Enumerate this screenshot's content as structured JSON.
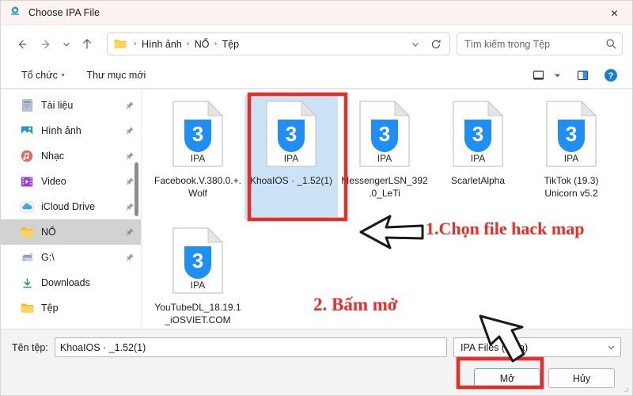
{
  "window": {
    "title": "Choose IPA File",
    "title_icon": "gear-app-icon",
    "close_label": "✕"
  },
  "nav": {
    "back": "back-arrow",
    "forward": "forward-arrow",
    "recent": "recent-dropdown",
    "up": "up-arrow",
    "refresh_label": "refresh-icon",
    "breadcrumb_dropdown": "chevron-down-icon"
  },
  "address": {
    "crumbs": [
      "Hình ảnh",
      "NỔ",
      "Tệp"
    ],
    "separator": "›"
  },
  "search": {
    "placeholder": "Tìm kiếm trong Tệp",
    "value": "",
    "icon": "search-icon"
  },
  "commandbar": {
    "organize": "Tổ chức",
    "organize_caret": "▾",
    "new_folder": "Thư mục mới",
    "view_icon": "view-layout-icon",
    "view_caret": "▾",
    "pane_icon": "preview-pane-icon",
    "help_icon": "help-icon"
  },
  "sidebar": {
    "items": [
      {
        "label": "Tài liệu",
        "icon": "documents-icon",
        "pinned": true,
        "selected": false
      },
      {
        "label": "Hình ảnh",
        "icon": "pictures-icon",
        "pinned": true,
        "selected": false
      },
      {
        "label": "Nhạc",
        "icon": "music-icon",
        "pinned": true,
        "selected": false
      },
      {
        "label": "Video",
        "icon": "video-icon",
        "pinned": true,
        "selected": false
      },
      {
        "label": "iCloud Drive",
        "icon": "icloud-icon",
        "pinned": true,
        "selected": false
      },
      {
        "label": "NỔ",
        "icon": "folder-icon",
        "pinned": true,
        "selected": true
      },
      {
        "label": "G:\\",
        "icon": "drive-icon",
        "pinned": true,
        "selected": false
      },
      {
        "label": "Downloads",
        "icon": "downloads-icon",
        "pinned": false,
        "selected": false
      },
      {
        "label": "Tệp",
        "icon": "folder-icon",
        "pinned": false,
        "selected": false
      }
    ]
  },
  "files": [
    {
      "name": "Facebook.V.380.0.+.Wolf",
      "type": "IPA",
      "selected": false
    },
    {
      "name": "KhoaIOS · _1.52(1)",
      "type": "IPA",
      "selected": true
    },
    {
      "name": "MessengerLSN_392.0_LeTi",
      "type": "IPA",
      "selected": false
    },
    {
      "name": "ScarletAlpha",
      "type": "IPA",
      "selected": false
    },
    {
      "name": "TikTok (19.3) Unicorn v5.2",
      "type": "IPA",
      "selected": false
    },
    {
      "name": "YouTubeDL_18.19.1_iOSVIET.COM",
      "type": "IPA",
      "selected": false
    }
  ],
  "footer": {
    "filename_label": "Tên tệp:",
    "filename_value": "KhoaIOS · _1.52(1)",
    "filename_placeholder": "",
    "filter_value": "IPA Files (*.ipa)",
    "filter_caret": "⌄",
    "open_button": "Mở",
    "cancel_button": "Hủy"
  },
  "annotations": [
    {
      "text": "1.Chọn file hack map",
      "color": "#ed2a26"
    },
    {
      "text": "2. Bấm mở",
      "color": "#ed2a26"
    }
  ],
  "colors": {
    "accent_red": "#ed2a26",
    "selection_blue": "#cce3f5",
    "ipa_blue": "#1f8ff5",
    "titlebar": "#fbf2f2"
  }
}
